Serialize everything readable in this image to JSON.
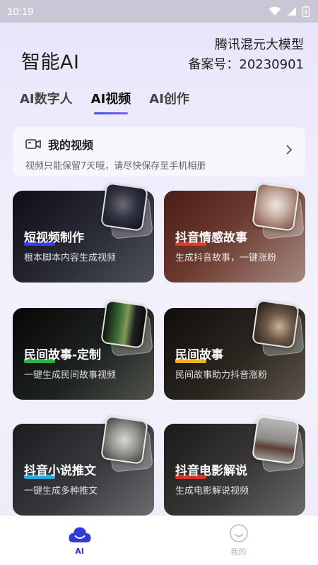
{
  "status_bar": {
    "time": "10:19"
  },
  "header": {
    "app_title": "智能AI",
    "model_line1": "腾讯混元大模型",
    "model_line2": "备案号：20230901"
  },
  "tabs": [
    {
      "label": "AI数字人"
    },
    {
      "label": "AI视频"
    },
    {
      "label": "AI创作"
    }
  ],
  "my_videos": {
    "title": "我的视频",
    "subtitle": "视频只能保留7天哦，请尽快保存至手机相册"
  },
  "cards": [
    {
      "title": "短视频制作",
      "subtitle": "根本脚本内容生成视频",
      "accent": "#3a3cf0"
    },
    {
      "title": "抖音情感故事",
      "subtitle": "生成抖音故事，一键涨粉",
      "accent": "#e03a2f"
    },
    {
      "title": "民间故事-定制",
      "subtitle": "一键生成民间故事视频",
      "accent": "#2bb34a"
    },
    {
      "title": "民间故事",
      "subtitle": "民间故事助力抖音涨粉",
      "accent": "#f0b21f"
    },
    {
      "title": "抖音小说推文",
      "subtitle": "一键生成多种推文",
      "accent": "#2aa9e8"
    },
    {
      "title": "抖音电影解说",
      "subtitle": "生成电影解说视频",
      "accent": "#d8352a"
    }
  ],
  "bottom_nav": [
    {
      "label": "AI",
      "icon": "cloud-icon"
    },
    {
      "label": "我的",
      "icon": "smiley-icon"
    }
  ]
}
